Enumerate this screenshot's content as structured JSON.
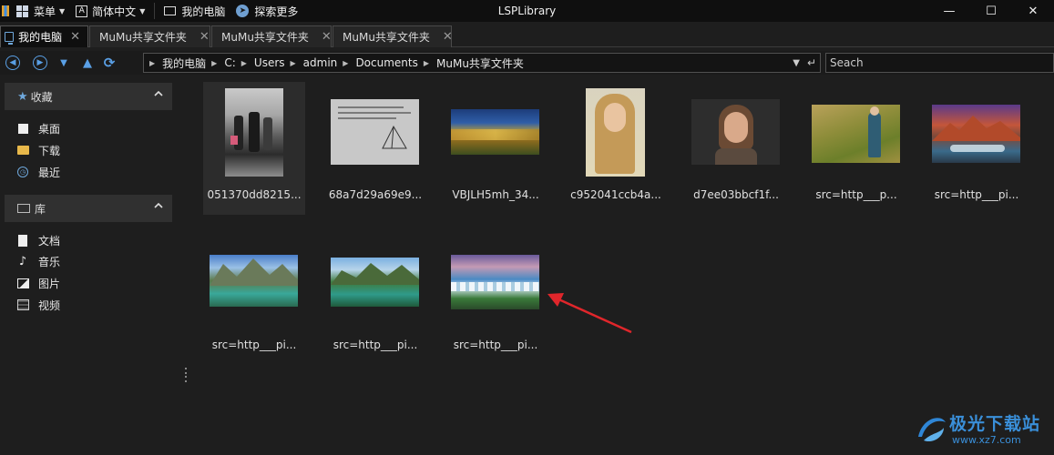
{
  "window": {
    "title": "LSPLibrary",
    "menu_label": "菜单",
    "language_label": "简体中文",
    "my_computer_label": "我的电脑",
    "explore_label": "探索更多",
    "minimize": "—",
    "maximize": "☐",
    "close": "✕"
  },
  "tabs": [
    {
      "label": "我的电脑",
      "close": "✕"
    },
    {
      "label": "MuMu共享文件夹",
      "close": "✕"
    },
    {
      "label": "MuMu共享文件夹",
      "close": "✕"
    },
    {
      "label": "MuMu共享文件夹",
      "close": "✕"
    }
  ],
  "address": {
    "breadcrumbs": [
      "我的电脑",
      "C:",
      "Users",
      "admin",
      "Documents",
      "MuMu共享文件夹"
    ]
  },
  "search": {
    "placeholder": "Seach"
  },
  "sidebar": {
    "favorites_title": "收藏",
    "favorites": [
      {
        "label": "桌面",
        "icon": "desktop-icon"
      },
      {
        "label": "下载",
        "icon": "download-folder-icon"
      },
      {
        "label": "最近",
        "icon": "clock-icon"
      }
    ],
    "library_title": "库",
    "library": [
      {
        "label": "文档",
        "icon": "document-icon"
      },
      {
        "label": "音乐",
        "icon": "music-icon"
      },
      {
        "label": "图片",
        "icon": "picture-icon"
      },
      {
        "label": "视频",
        "icon": "video-icon"
      }
    ]
  },
  "files": [
    {
      "name": "051370dd8215...",
      "selected": true
    },
    {
      "name": "68a7d29a69e9..."
    },
    {
      "name": "VBJLH5mh_34..."
    },
    {
      "name": "c952041ccb4a..."
    },
    {
      "name": "d7ee03bbcf1f..."
    },
    {
      "name": "src=http___p..."
    },
    {
      "name": "src=http___pi..."
    },
    {
      "name": "src=http___pi..."
    },
    {
      "name": "src=http___pi..."
    },
    {
      "name": "src=http___pi..."
    }
  ],
  "watermark": {
    "text": "极光下载站",
    "url": "www.xz7.com"
  },
  "colors": {
    "accent": "#5aa0e6",
    "arrow": "#e0262b"
  }
}
